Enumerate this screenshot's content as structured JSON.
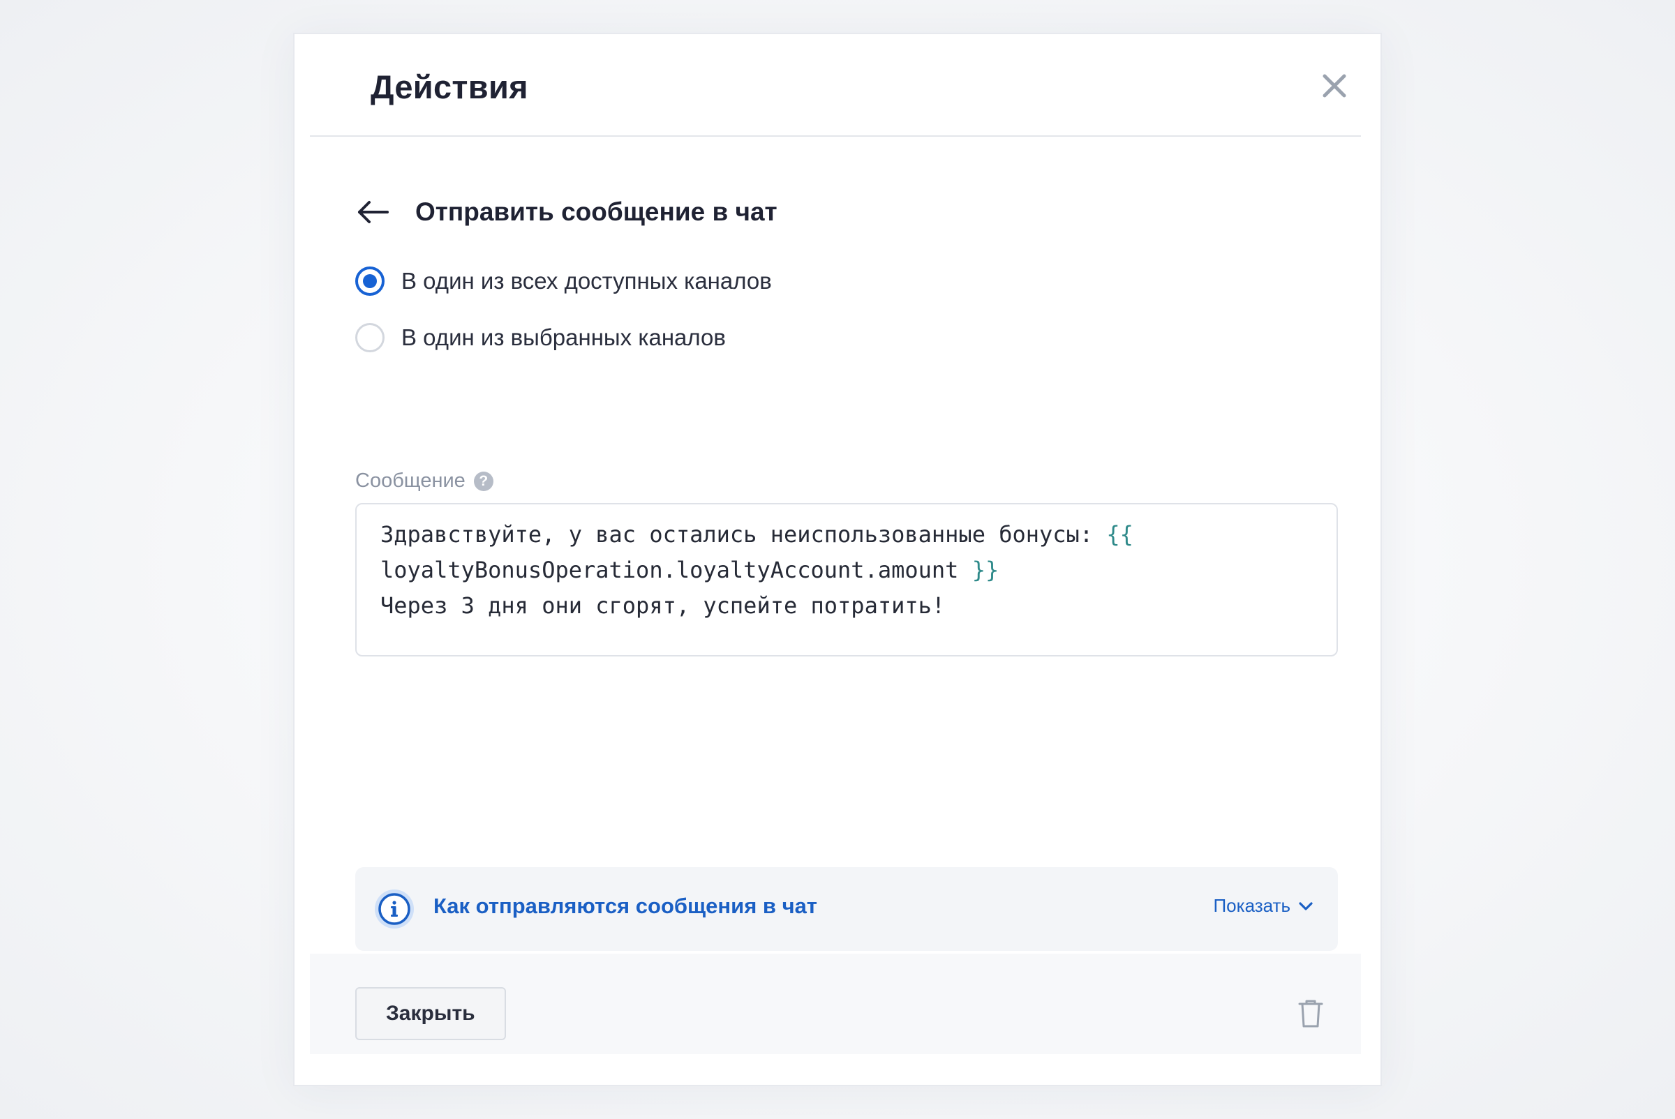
{
  "modal": {
    "title": "Действия",
    "close_icon": "close-icon"
  },
  "action": {
    "title": "Отправить сообщение в чат",
    "back_icon": "arrow-left-icon"
  },
  "channel_options": [
    {
      "label": "В один из всех доступных каналов",
      "selected": true
    },
    {
      "label": "В один из выбранных каналов",
      "selected": false
    }
  ],
  "message": {
    "label": "Сообщение",
    "help_icon": "question-icon",
    "line1_text": "Здравствуйте, у вас остались неиспользованные бонусы: ",
    "line1_tpl": "{{",
    "line2_text": "loyaltyBonusOperation.loyaltyAccount.amount ",
    "line2_tpl": "}}",
    "line3_text": "Через 3 дня они сгорят, успейте потратить!"
  },
  "info": {
    "text": "Как отправляются сообщения в чат",
    "toggle_label": "Показать",
    "icon": "info-icon"
  },
  "footer": {
    "close_label": "Закрыть",
    "delete_icon": "trash-icon"
  },
  "colors": {
    "accent": "#1762d4",
    "link": "#1a5fc4",
    "template": "#2f8a8a",
    "text": "#1f2233"
  }
}
